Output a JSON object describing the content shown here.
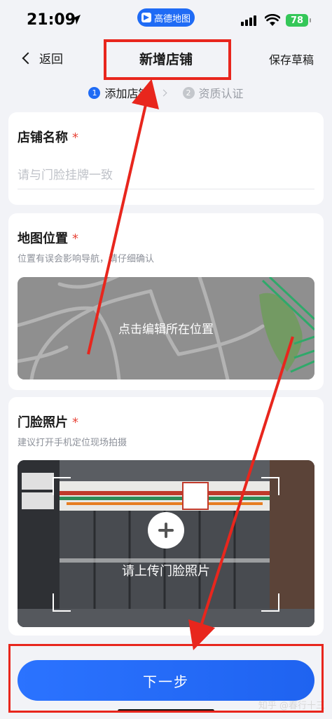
{
  "status_bar": {
    "time": "21:09",
    "app_name": "高德地图",
    "battery": "78"
  },
  "nav": {
    "back_label": "返回",
    "title": "新增店铺",
    "save_draft_label": "保存草稿"
  },
  "steps": [
    {
      "num": "1",
      "label": "添加店铺",
      "state": "active"
    },
    {
      "num": "2",
      "label": "资质认证",
      "state": "inactive"
    }
  ],
  "store_name": {
    "title": "店铺名称",
    "required_mark": "*",
    "placeholder": "请与门脸挂牌一致"
  },
  "map_location": {
    "title": "地图位置",
    "required_mark": "*",
    "hint": "位置有误会影响导航，请仔细确认",
    "button_label": "点击编辑所在位置"
  },
  "storefront_photo": {
    "title": "门脸照片",
    "required_mark": "*",
    "hint": "建议打开手机定位现场拍摄",
    "button_label": "请上传门脸照片"
  },
  "next_button_label": "下一步",
  "watermark": "知乎 @春行十三",
  "colors": {
    "accent": "#1f6bf5",
    "required": "#e8463a",
    "annotation": "#e8261d"
  }
}
